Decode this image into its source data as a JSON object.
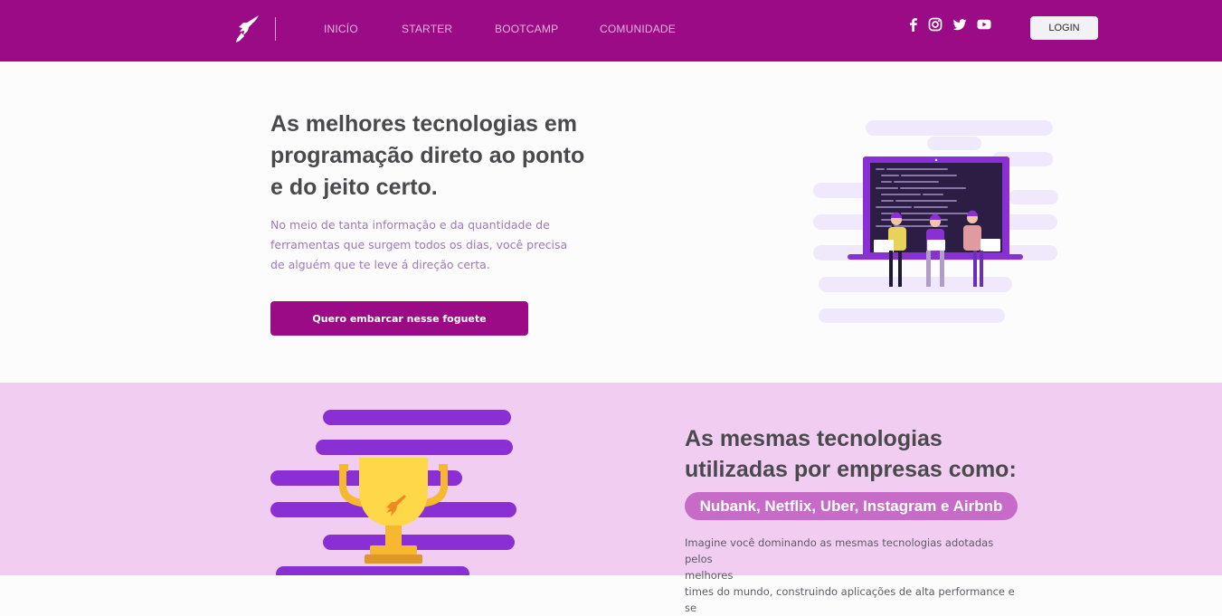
{
  "header": {
    "logo_icon": "rocket-icon",
    "nav": [
      {
        "label": "INICÍO"
      },
      {
        "label": "STARTER"
      },
      {
        "label": "BOOTCAMP"
      },
      {
        "label": "COMUNIDADE"
      }
    ],
    "social": [
      "facebook-icon",
      "instagram-icon",
      "twitter-icon",
      "youtube-icon"
    ],
    "login_label": "LOGIN"
  },
  "hero": {
    "title": "As melhores tecnologias em programação direto ao ponto e do jeito certo.",
    "text": "No meio de tanta informação e da quantidade de ferramentas que surgem todos os dias, você precisa de alguém que te leve á direção certa.",
    "cta_label": "Quero embarcar nesse foguete"
  },
  "section2": {
    "title": "As mesmas tecnologias utilizadas por empresas como:",
    "companies": "Nubank, Netflix, Uber, Instagram e Airbnb",
    "text_lines": [
      "Imagine você dominando as mesmas tecnologias adotadas pelos",
      "melhores",
      "times do mundo, construindo aplicações de alta performance e se"
    ]
  },
  "colors": {
    "brand": "#9b0b86",
    "section_bg": "#f1cdf2",
    "badge": "#c76bc9",
    "accent_purple": "#8a2fd4",
    "trophy_gold": "#f5b82e"
  }
}
